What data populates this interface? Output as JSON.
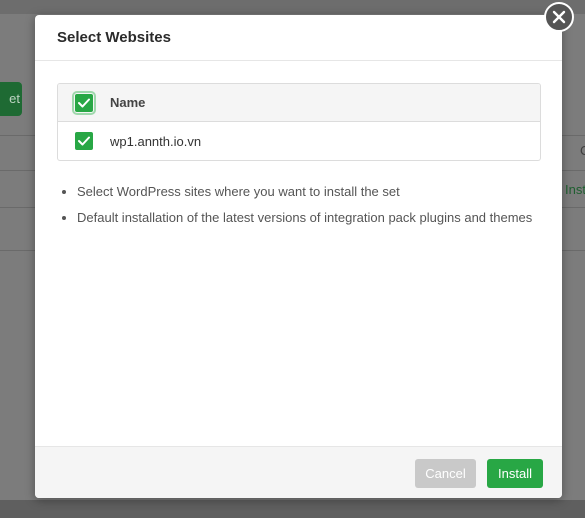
{
  "background": {
    "left_button_fragment": "et",
    "right_text_fragment": "C",
    "right_link_fragment": "Inst"
  },
  "modal": {
    "title": "Select Websites",
    "close_icon": "close-icon",
    "table": {
      "header": {
        "name": "Name",
        "checked": true
      },
      "rows": [
        {
          "name": "wp1.annth.io.vn",
          "checked": true
        }
      ]
    },
    "notes": [
      "Select WordPress sites where you want to install the set",
      "Default installation of the latest versions of integration pack plugins and themes"
    ],
    "footer": {
      "cancel_label": "Cancel",
      "install_label": "Install"
    }
  },
  "colors": {
    "accent": "#28a745",
    "cancel": "#c9c9c9"
  }
}
